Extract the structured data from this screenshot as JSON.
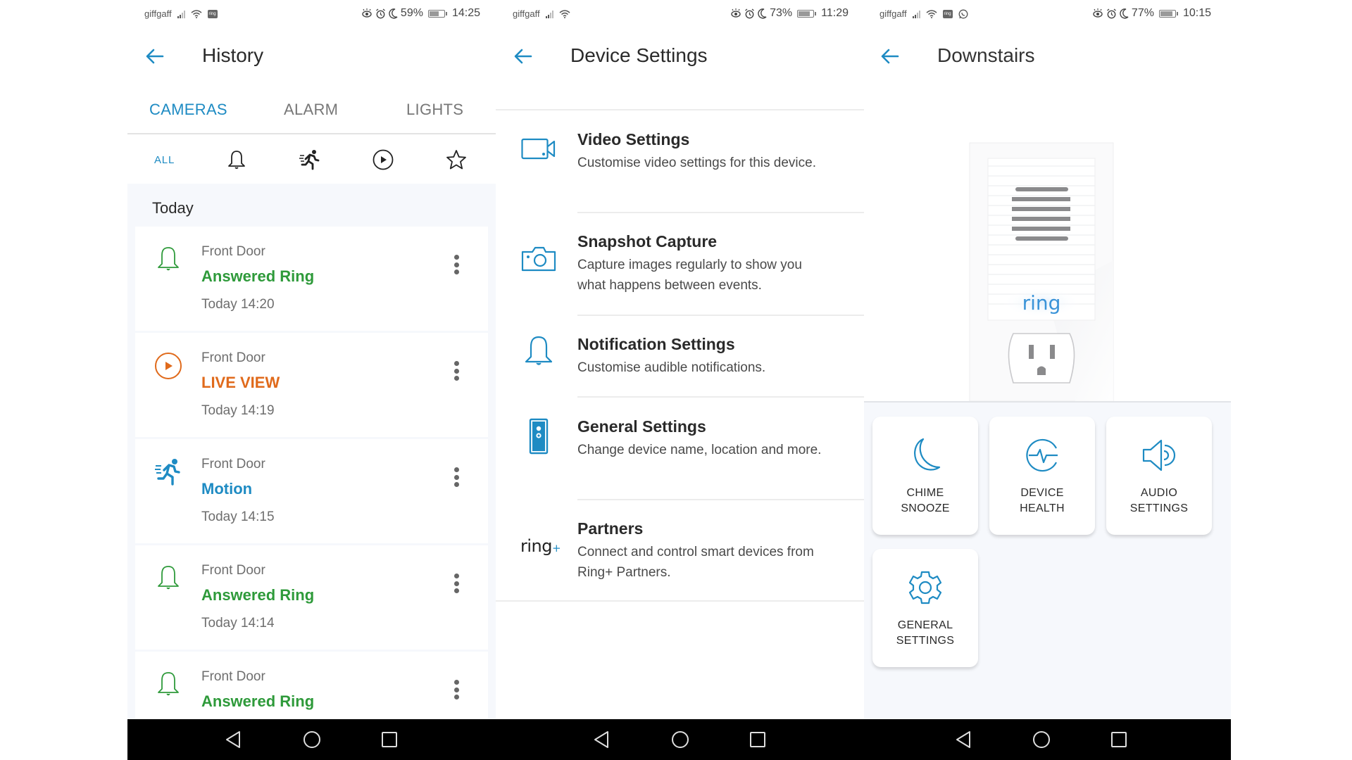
{
  "colors": {
    "accent": "#1e8bc3",
    "ring_green": "#2e9a3a",
    "live_orange": "#e06a1b",
    "motion_blue": "#1e8bc3"
  },
  "panels": [
    {
      "status": {
        "carrier": "giffgaff",
        "battery": "59%",
        "battery_level": 0.59,
        "time": "14:25",
        "icons": [
          "signal-icon",
          "wifi-icon",
          "ring-app-icon",
          "eye-comfort-icon",
          "alarm-icon",
          "do-not-disturb-icon",
          "battery-icon"
        ]
      },
      "header": {
        "back_icon": "arrow-left-icon",
        "title": "History"
      },
      "tabs": [
        {
          "label": "CAMERAS",
          "active": true
        },
        {
          "label": "ALARM",
          "active": false
        },
        {
          "label": "LIGHTS",
          "active": false
        }
      ],
      "filters": [
        {
          "label": "ALL",
          "icon": null,
          "active": true
        },
        {
          "label": "",
          "icon": "bell-icon"
        },
        {
          "label": "",
          "icon": "motion-runner-icon"
        },
        {
          "label": "",
          "icon": "play-circle-icon"
        },
        {
          "label": "",
          "icon": "star-icon"
        }
      ],
      "section": "Today",
      "events": [
        {
          "camera": "Front Door",
          "type": "Answered Ring",
          "time": "Today 14:20",
          "icon": "bell-icon",
          "color": "#2e9a3a"
        },
        {
          "camera": "Front Door",
          "type": "LIVE VIEW",
          "time": "Today 14:19",
          "icon": "play-circle-icon",
          "color": "#e06a1b"
        },
        {
          "camera": "Front Door",
          "type": "Motion",
          "time": "Today 14:15",
          "icon": "motion-runner-icon",
          "color": "#1e8bc3"
        },
        {
          "camera": "Front Door",
          "type": "Answered Ring",
          "time": "Today 14:14",
          "icon": "bell-icon",
          "color": "#2e9a3a"
        },
        {
          "camera": "Front Door",
          "type": "Answered Ring",
          "time": "",
          "icon": "bell-icon",
          "color": "#2e9a3a"
        }
      ]
    },
    {
      "status": {
        "carrier": "giffgaff",
        "battery": "73%",
        "battery_level": 0.73,
        "time": "11:29"
      },
      "header": {
        "back_icon": "arrow-left-icon",
        "title": "Device Settings"
      },
      "items": [
        {
          "title": "Video Settings",
          "desc": "Customise video settings for this device.",
          "icon": "video-camera-icon"
        },
        {
          "title": "Snapshot Capture",
          "desc": "Capture images regularly to show you what happens between events.",
          "icon": "photo-camera-icon"
        },
        {
          "title": "Notification Settings",
          "desc": "Customise audible notifications.",
          "icon": "bell-icon"
        },
        {
          "title": "General Settings",
          "desc": "Change device name, location and more.",
          "icon": "doorbell-device-icon"
        },
        {
          "title": "Partners",
          "desc": "Connect and control smart devices from Ring+ Partners.",
          "icon": "ring-plus-logo",
          "logo_text": "ring",
          "logo_plus": "+"
        }
      ]
    },
    {
      "status": {
        "carrier": "giffgaff",
        "battery": "77%",
        "battery_level": 0.77,
        "time": "10:15"
      },
      "header": {
        "back_icon": "arrow-left-icon",
        "title": "Downstairs"
      },
      "device_image": {
        "brand_text": "ring",
        "alt": "Ring Chime plugged into wall outlet"
      },
      "tiles": [
        {
          "label": "CHIME\nSNOOZE",
          "icon": "moon-icon"
        },
        {
          "label": "DEVICE\nHEALTH",
          "icon": "heartbeat-icon"
        },
        {
          "label": "AUDIO\nSETTINGS",
          "icon": "speaker-icon"
        },
        {
          "label": "GENERAL\nSETTINGS",
          "icon": "gear-icon"
        }
      ]
    }
  ],
  "navbar": {
    "buttons": [
      "back-nav-icon",
      "home-nav-icon",
      "recents-nav-icon"
    ]
  }
}
